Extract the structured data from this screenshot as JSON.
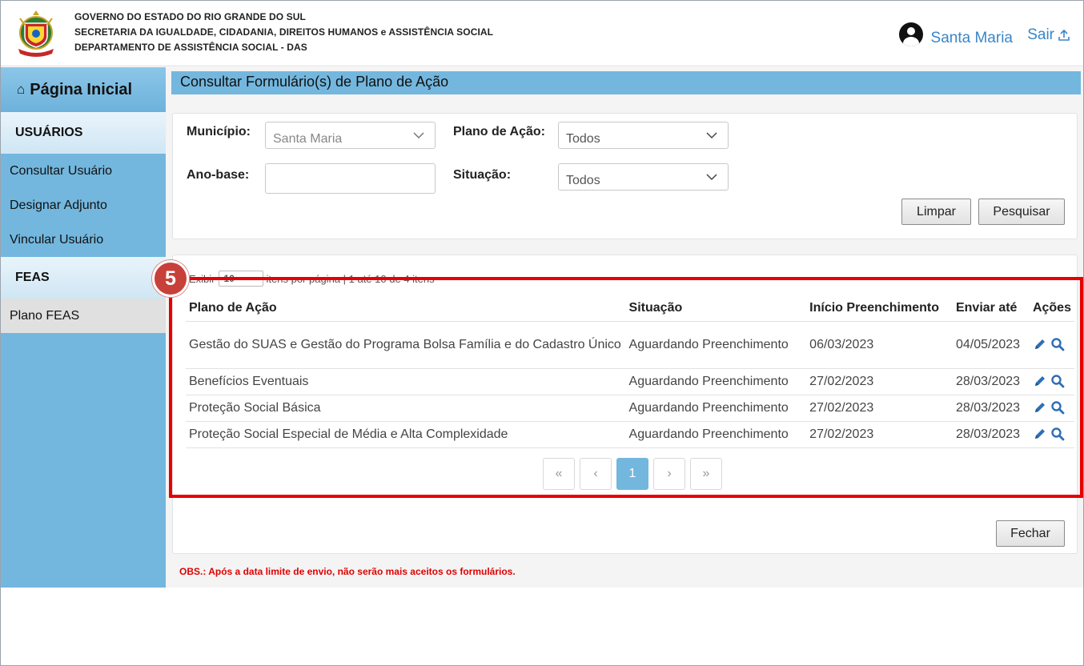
{
  "header": {
    "gov_line1": "GOVERNO DO ESTADO DO RIO GRANDE DO SUL",
    "gov_line2": "SECRETARIA DA IGUALDADE, CIDADANIA, DIREITOS HUMANOS e ASSISTÊNCIA SOCIAL",
    "gov_line3": "DEPARTAMENTO DE ASSISTÊNCIA SOCIAL - DAS",
    "user_name": "Santa Maria",
    "logout_label": "Sair"
  },
  "sidebar": {
    "home_label": "Página Inicial",
    "section_users": "USUÁRIOS",
    "users_items": [
      "Consultar Usuário",
      "Designar Adjunto",
      "Vincular Usuário"
    ],
    "section_feas": "FEAS",
    "feas_items": [
      "Plano FEAS"
    ]
  },
  "page": {
    "title": "Consultar Formulário(s) de Plano de Ação"
  },
  "filters": {
    "municipio_label": "Município:",
    "municipio_value": "Santa Maria",
    "plano_label": "Plano de Ação:",
    "plano_value": "Todos",
    "ano_label": "Ano-base:",
    "ano_value": "",
    "situacao_label": "Situação:",
    "situacao_value": "Todos",
    "clear_label": "Limpar",
    "search_label": "Pesquisar"
  },
  "results": {
    "per_page_prefix": "Exibir",
    "per_page_value": "10",
    "per_page_suffix": "itens por página | 1 até 10 de 4 itens",
    "columns": [
      "Plano de Ação",
      "Situação",
      "Início Preenchimento",
      "Enviar até",
      "Ações"
    ],
    "rows": [
      {
        "plano": "Gestão do SUAS e Gestão do Programa Bolsa Família e do Cadastro Único",
        "situacao": "Aguardando Preenchimento",
        "inicio": "06/03/2023",
        "enviar": "04/05/2023"
      },
      {
        "plano": "Benefícios Eventuais",
        "situacao": "Aguardando Preenchimento",
        "inicio": "27/02/2023",
        "enviar": "28/03/2023"
      },
      {
        "plano": "Proteção Social Básica",
        "situacao": "Aguardando Preenchimento",
        "inicio": "27/02/2023",
        "enviar": "28/03/2023"
      },
      {
        "plano": "Proteção Social Especial de Média e Alta Complexidade",
        "situacao": "Aguardando Preenchimento",
        "inicio": "27/02/2023",
        "enviar": "28/03/2023"
      }
    ],
    "pager": {
      "first": "«",
      "prev": "‹",
      "current": "1",
      "next": "›",
      "last": "»"
    },
    "close_label": "Fechar"
  },
  "annotation": {
    "step_number": "5",
    "color": "#e60000"
  },
  "obs_text": "OBS.: Após a data limite de envio, não serão mais aceitos os formulários.",
  "icons": {
    "edit": "pencil-icon",
    "view": "magnifier-icon",
    "home": "home-icon",
    "user": "user-icon",
    "logout": "upload-icon"
  }
}
